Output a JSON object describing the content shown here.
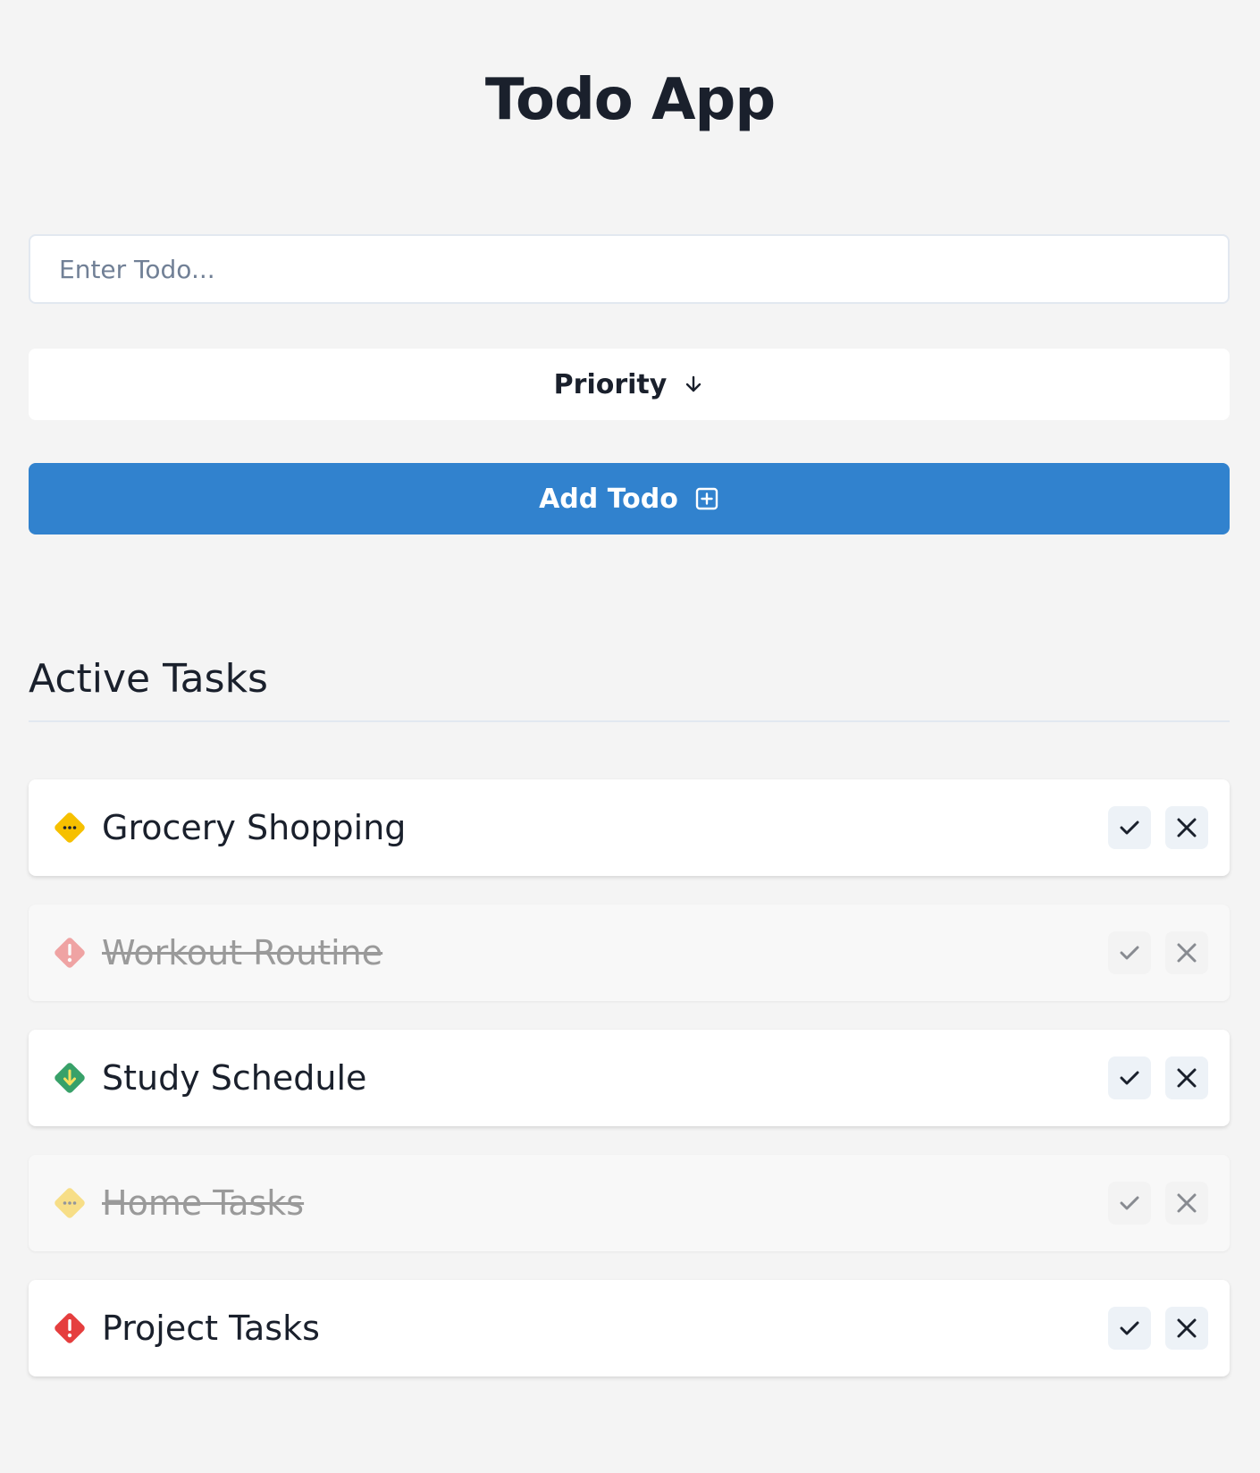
{
  "app": {
    "title": "Todo App"
  },
  "form": {
    "input_placeholder": "Enter Todo...",
    "input_value": "",
    "priority_label": "Priority",
    "add_label": "Add Todo"
  },
  "section": {
    "title": "Active Tasks"
  },
  "colors": {
    "accent": "#3182ce",
    "priority_high": "#e53e3e",
    "priority_medium": "#f6c000",
    "priority_low": "#38a169",
    "background": "#f4f4f4"
  },
  "tasks": [
    {
      "label": "Grocery Shopping",
      "priority": "medium",
      "priority_icon": "ellipsis-diamond-icon",
      "completed": false
    },
    {
      "label": "Workout Routine",
      "priority": "high",
      "priority_icon": "exclamation-diamond-icon",
      "completed": true
    },
    {
      "label": "Study Schedule",
      "priority": "low",
      "priority_icon": "arrow-down-diamond-icon",
      "completed": false
    },
    {
      "label": "Home Tasks",
      "priority": "medium",
      "priority_icon": "ellipsis-diamond-icon",
      "completed": true
    },
    {
      "label": "Project Tasks",
      "priority": "high",
      "priority_icon": "exclamation-diamond-icon",
      "completed": false
    }
  ]
}
